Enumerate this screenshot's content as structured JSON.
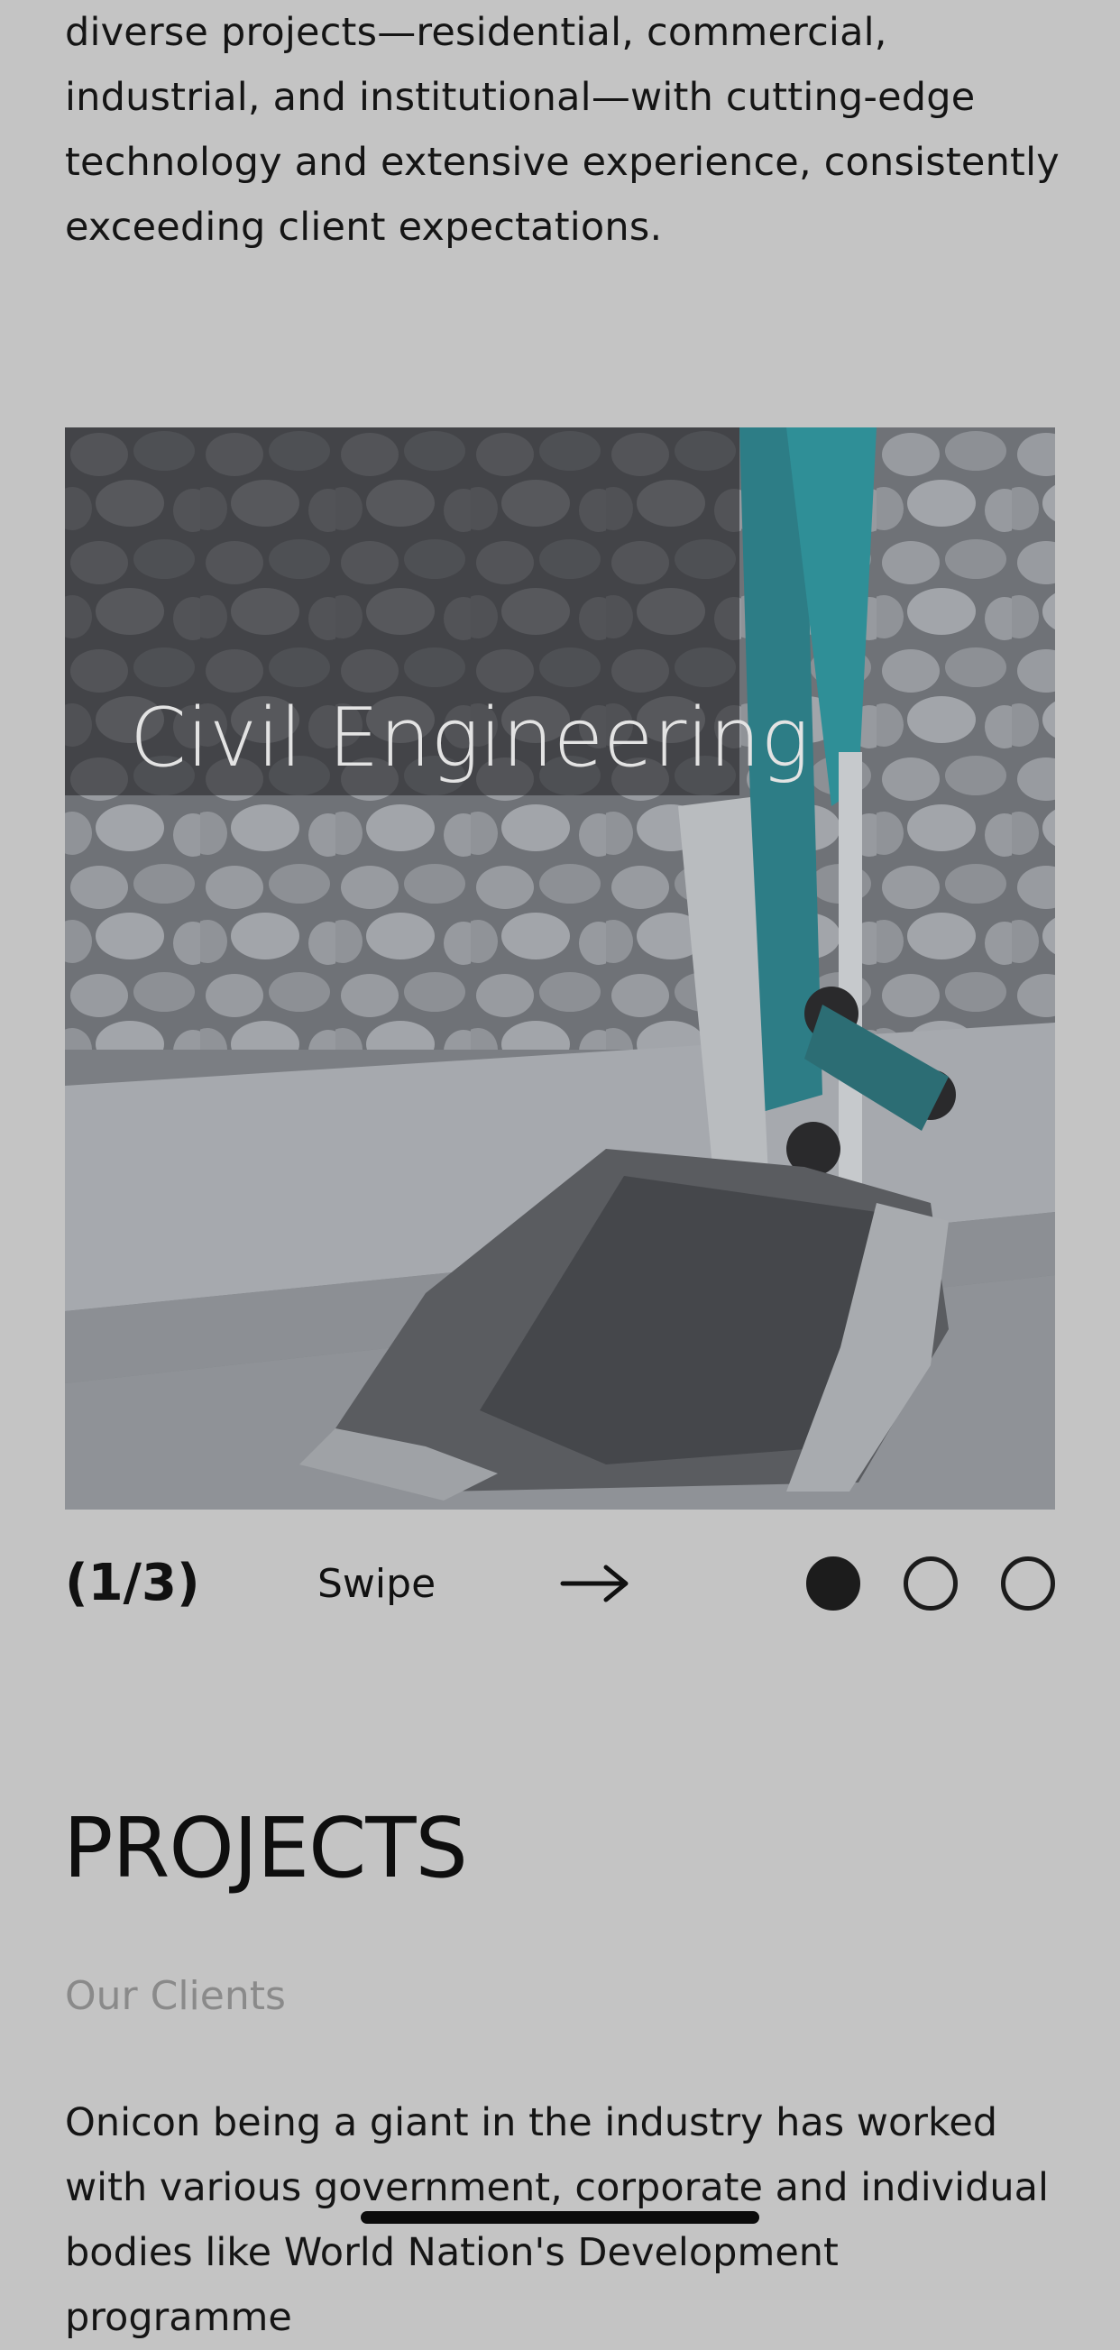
{
  "intro": {
    "text": "diverse projects—residential, commercial, industrial, and institutional—with cutting-edge technology and extensive experience, consistently exceeding client expectations."
  },
  "carousel": {
    "slide_label": "Civil Engineering",
    "counter": "(1/3)",
    "swipe_label": "Swipe",
    "total_slides": 3,
    "active_index": 1
  },
  "projects": {
    "title": "PROJECTS",
    "subtitle": "Our Clients",
    "body": "Onicon being a giant in the industry has worked with various government, corporate and individual bodies like World Nation's Development programme"
  },
  "colors": {
    "background": "#c4c4c4",
    "text": "#151515",
    "muted": "#8a8a8a",
    "excavator_teal": "#2f8f97"
  },
  "icons": {
    "arrow": "arrow-right-icon"
  }
}
